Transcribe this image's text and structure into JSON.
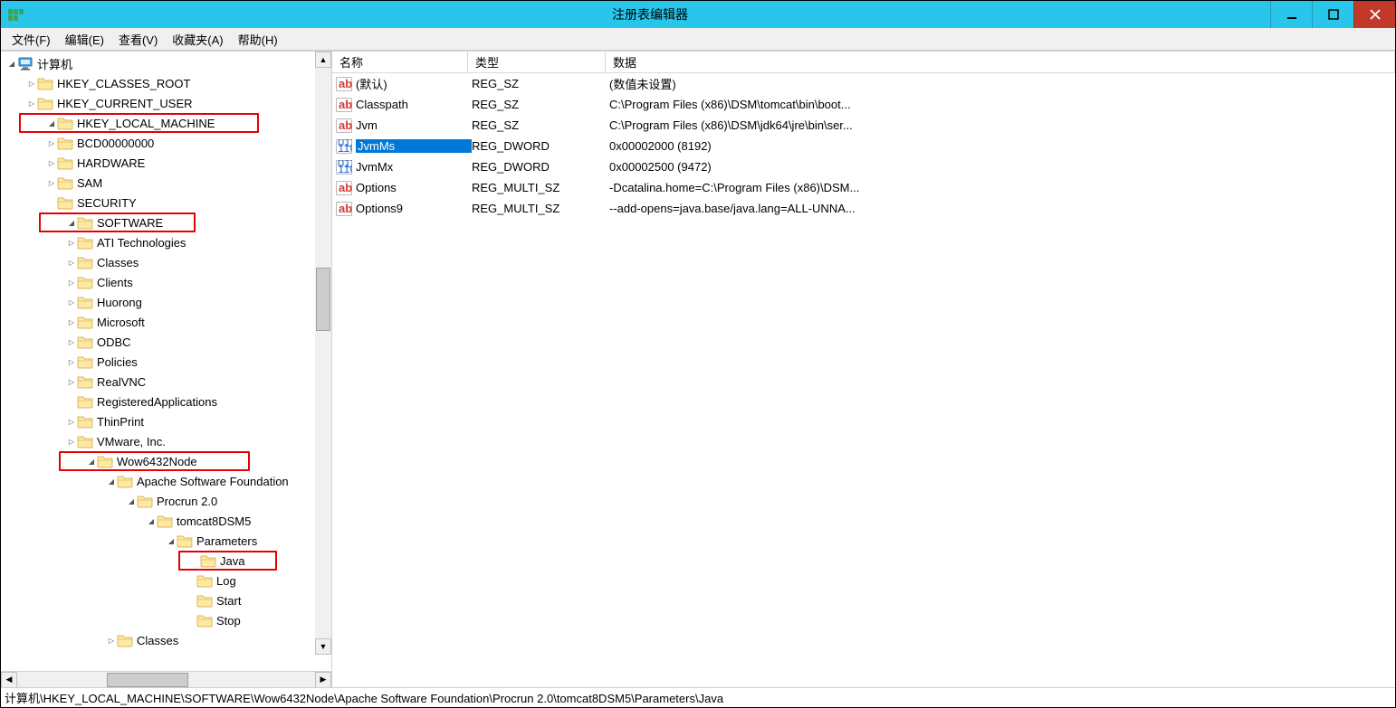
{
  "window": {
    "title": "注册表编辑器"
  },
  "menu": {
    "file": "文件(F)",
    "edit": "编辑(E)",
    "view": "查看(V)",
    "favorites": "收藏夹(A)",
    "help": "帮助(H)"
  },
  "tree": {
    "root": "计算机",
    "hkcr": "HKEY_CLASSES_ROOT",
    "hkcu": "HKEY_CURRENT_USER",
    "hklm": "HKEY_LOCAL_MACHINE",
    "bcd": "BCD00000000",
    "hardware": "HARDWARE",
    "sam": "SAM",
    "security": "SECURITY",
    "software": "SOFTWARE",
    "ati": "ATI Technologies",
    "classes": "Classes",
    "clients": "Clients",
    "huorong": "Huorong",
    "microsoft": "Microsoft",
    "odbc": "ODBC",
    "policies": "Policies",
    "realvnc": "RealVNC",
    "regapps": "RegisteredApplications",
    "thinprint": "ThinPrint",
    "vmware": "VMware, Inc.",
    "wow64": "Wow6432Node",
    "asf": "Apache Software Foundation",
    "procrun": "Procrun 2.0",
    "tomcat": "tomcat8DSM5",
    "parameters": "Parameters",
    "java": "Java",
    "log": "Log",
    "start": "Start",
    "stop": "Stop",
    "classes2": "Classes"
  },
  "columns": {
    "name": "名称",
    "type": "类型",
    "data": "数据"
  },
  "values": [
    {
      "icon": "ab",
      "name": "(默认)",
      "type": "REG_SZ",
      "data": "(数值未设置)",
      "selected": false
    },
    {
      "icon": "ab",
      "name": "Classpath",
      "type": "REG_SZ",
      "data": "C:\\Program Files (x86)\\DSM\\tomcat\\bin\\boot...",
      "selected": false
    },
    {
      "icon": "ab",
      "name": "Jvm",
      "type": "REG_SZ",
      "data": "C:\\Program Files (x86)\\DSM\\jdk64\\jre\\bin\\ser...",
      "selected": false
    },
    {
      "icon": "bin",
      "name": "JvmMs",
      "type": "REG_DWORD",
      "data": "0x00002000 (8192)",
      "selected": true
    },
    {
      "icon": "bin",
      "name": "JvmMx",
      "type": "REG_DWORD",
      "data": "0x00002500 (9472)",
      "selected": false
    },
    {
      "icon": "ab",
      "name": "Options",
      "type": "REG_MULTI_SZ",
      "data": "-Dcatalina.home=C:\\Program Files (x86)\\DSM...",
      "selected": false
    },
    {
      "icon": "ab",
      "name": "Options9",
      "type": "REG_MULTI_SZ",
      "data": "--add-opens=java.base/java.lang=ALL-UNNA...",
      "selected": false
    }
  ],
  "statusbar": {
    "path": "计算机\\HKEY_LOCAL_MACHINE\\SOFTWARE\\Wow6432Node\\Apache Software Foundation\\Procrun 2.0\\tomcat8DSM5\\Parameters\\Java"
  }
}
